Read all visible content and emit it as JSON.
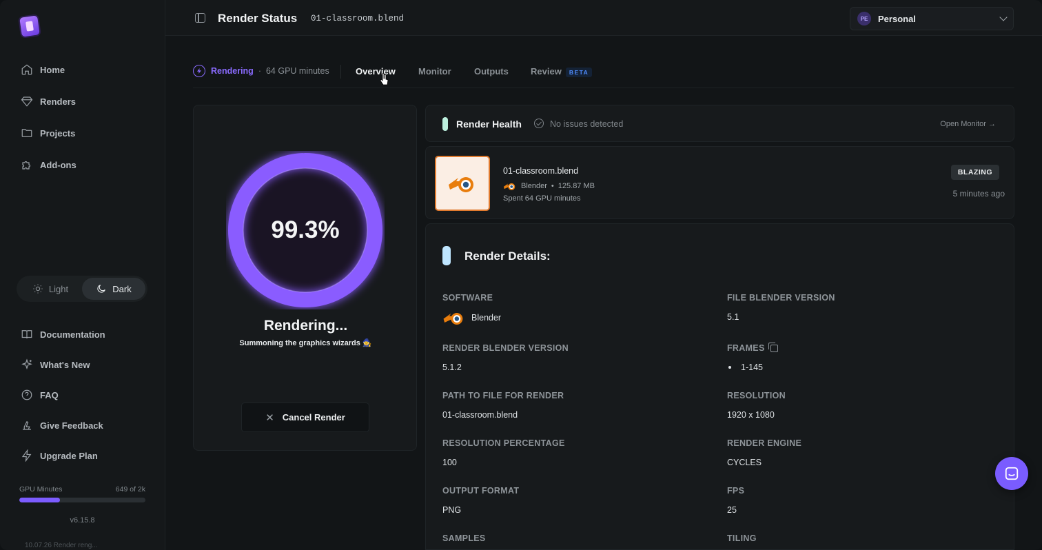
{
  "app": {
    "title": "Render Status",
    "file": "01-classroom.blend"
  },
  "workspace": {
    "initials": "PE",
    "name": "Personal"
  },
  "sidebar": {
    "items": [
      {
        "label": "Home",
        "icon": "home-icon"
      },
      {
        "label": "Renders",
        "icon": "diamond-icon"
      },
      {
        "label": "Projects",
        "icon": "folder-icon"
      },
      {
        "label": "Add-ons",
        "icon": "puzzle-icon"
      }
    ],
    "theme": {
      "light": "Light",
      "dark": "Dark",
      "selected": "Dark"
    },
    "secondary": [
      {
        "label": "Documentation",
        "icon": "book-icon"
      },
      {
        "label": "What's New",
        "icon": "sparkle-icon"
      },
      {
        "label": "FAQ",
        "icon": "help-icon"
      },
      {
        "label": "Give Feedback",
        "icon": "feedback-icon"
      },
      {
        "label": "Upgrade Plan",
        "icon": "bolt-icon"
      }
    ],
    "gpu": {
      "label": "GPU Minutes",
      "usage": "649 of 2k",
      "fraction": 0.32
    },
    "version": "v6.15.8",
    "peek": "10.07.26   Render reng..."
  },
  "status": {
    "state": "Rendering",
    "minutes": "64 GPU minutes"
  },
  "tabs": [
    {
      "label": "Overview",
      "active": true
    },
    {
      "label": "Monitor",
      "active": false
    },
    {
      "label": "Outputs",
      "active": false
    },
    {
      "label": "Review",
      "active": false,
      "badge": "BETA"
    }
  ],
  "progress": {
    "percent_text": "99.3%",
    "fraction": 0.993,
    "title": "Rendering...",
    "subtitle": "Summoning the graphics wizards 🧙",
    "cancel_label": "Cancel Render"
  },
  "health": {
    "title": "Render Health",
    "status": "No issues detected",
    "link": "Open Monitor →"
  },
  "file": {
    "name": "01-classroom.blend",
    "software": "Blender",
    "size": "125.87 MB",
    "spent": "Spent 64 GPU minutes",
    "badge": "BLAZING",
    "time": "5 minutes ago"
  },
  "details": {
    "title": "Render Details:",
    "fields": [
      {
        "label": "SOFTWARE",
        "value": "Blender"
      },
      {
        "label": "FILE BLENDER VERSION",
        "value": "5.1"
      },
      {
        "label": "RENDER BLENDER VERSION",
        "value": "5.1.2"
      },
      {
        "label": "FRAMES",
        "value": "1-145"
      },
      {
        "label": "PATH TO FILE FOR RENDER",
        "value": "01-classroom.blend"
      },
      {
        "label": "RESOLUTION",
        "value": "1920 x 1080"
      },
      {
        "label": "RESOLUTION PERCENTAGE",
        "value": "100"
      },
      {
        "label": "RENDER ENGINE",
        "value": "CYCLES"
      },
      {
        "label": "OUTPUT FORMAT",
        "value": "PNG"
      },
      {
        "label": "FPS",
        "value": "25"
      },
      {
        "label": "SAMPLES",
        "value": ""
      },
      {
        "label": "TILING",
        "value": ""
      }
    ]
  },
  "colors": {
    "accent": "#8a6bff",
    "health_bar": "#bdf0de",
    "details_bar": "#bfe6ff",
    "blender_orange": "#e87d0d"
  }
}
